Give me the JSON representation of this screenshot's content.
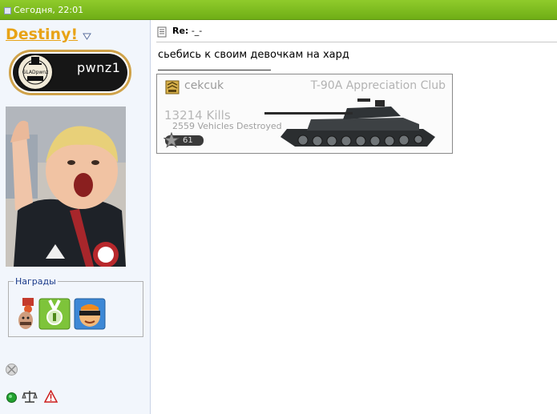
{
  "header": {
    "date_text": "Сегодня, 22:01"
  },
  "user": {
    "name": "Destiny!",
    "banner_text": "pwnz1",
    "banner_seal_text": "GLADpwnz"
  },
  "awards": {
    "legend": "Награды"
  },
  "post": {
    "title_prefix": "Re:",
    "title": " -_-",
    "message": "сьебись к своим девочкам на хард"
  },
  "signature": {
    "player": "cekcuk",
    "club": "T-90A Appreciation Club",
    "kills": "13214 Kills",
    "vehicles": "2559  Vehicles Destroyed",
    "rank": "61"
  },
  "colors": {
    "header_green": "#7dbd20",
    "username": "#e8a317",
    "sidebar_bg": "#f2f6fc"
  }
}
